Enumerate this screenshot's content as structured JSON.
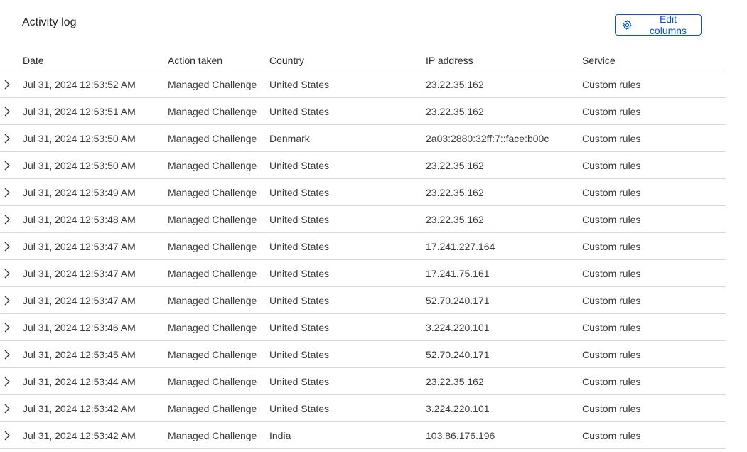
{
  "header": {
    "title": "Activity log",
    "edit_columns_label": "Edit columns"
  },
  "columns": [
    "Date",
    "Action taken",
    "Country",
    "IP address",
    "Service"
  ],
  "rows": [
    {
      "date": "Jul 31, 2024 12:53:52 AM",
      "action": "Managed Challenge",
      "country": "United States",
      "ip": "23.22.35.162",
      "service": "Custom rules"
    },
    {
      "date": "Jul 31, 2024 12:53:51 AM",
      "action": "Managed Challenge",
      "country": "United States",
      "ip": "23.22.35.162",
      "service": "Custom rules"
    },
    {
      "date": "Jul 31, 2024 12:53:50 AM",
      "action": "Managed Challenge",
      "country": "Denmark",
      "ip": "2a03:2880:32ff:7::face:b00c",
      "service": "Custom rules"
    },
    {
      "date": "Jul 31, 2024 12:53:50 AM",
      "action": "Managed Challenge",
      "country": "United States",
      "ip": "23.22.35.162",
      "service": "Custom rules"
    },
    {
      "date": "Jul 31, 2024 12:53:49 AM",
      "action": "Managed Challenge",
      "country": "United States",
      "ip": "23.22.35.162",
      "service": "Custom rules"
    },
    {
      "date": "Jul 31, 2024 12:53:48 AM",
      "action": "Managed Challenge",
      "country": "United States",
      "ip": "23.22.35.162",
      "service": "Custom rules"
    },
    {
      "date": "Jul 31, 2024 12:53:47 AM",
      "action": "Managed Challenge",
      "country": "United States",
      "ip": "17.241.227.164",
      "service": "Custom rules"
    },
    {
      "date": "Jul 31, 2024 12:53:47 AM",
      "action": "Managed Challenge",
      "country": "United States",
      "ip": "17.241.75.161",
      "service": "Custom rules"
    },
    {
      "date": "Jul 31, 2024 12:53:47 AM",
      "action": "Managed Challenge",
      "country": "United States",
      "ip": "52.70.240.171",
      "service": "Custom rules"
    },
    {
      "date": "Jul 31, 2024 12:53:46 AM",
      "action": "Managed Challenge",
      "country": "United States",
      "ip": "3.224.220.101",
      "service": "Custom rules"
    },
    {
      "date": "Jul 31, 2024 12:53:45 AM",
      "action": "Managed Challenge",
      "country": "United States",
      "ip": "52.70.240.171",
      "service": "Custom rules"
    },
    {
      "date": "Jul 31, 2024 12:53:44 AM",
      "action": "Managed Challenge",
      "country": "United States",
      "ip": "23.22.35.162",
      "service": "Custom rules"
    },
    {
      "date": "Jul 31, 2024 12:53:42 AM",
      "action": "Managed Challenge",
      "country": "United States",
      "ip": "3.224.220.101",
      "service": "Custom rules"
    },
    {
      "date": "Jul 31, 2024 12:53:42 AM",
      "action": "Managed Challenge",
      "country": "India",
      "ip": "103.86.176.196",
      "service": "Custom rules"
    }
  ],
  "icons": {
    "edit_columns": "gear-icon",
    "row_expand": "chevron-right-icon"
  },
  "colors": {
    "accent": "#0a55c8"
  }
}
